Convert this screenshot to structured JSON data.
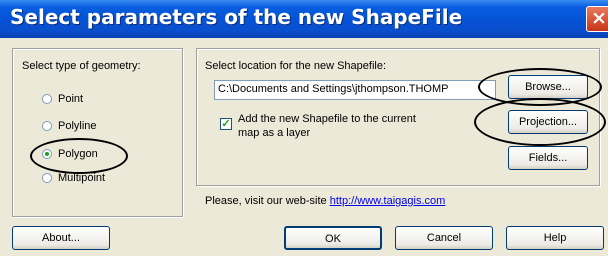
{
  "window": {
    "title": "Select parameters of the new ShapeFile",
    "close_glyph": "×"
  },
  "geometry": {
    "label": "Select type of geometry:",
    "options": [
      "Point",
      "Polyline",
      "Polygon",
      "Multipoint"
    ],
    "selected": "Polygon"
  },
  "location": {
    "label": "Select location for the new Shapefile:",
    "path_value": "C:\\Documents and Settings\\jthompson.THOMP",
    "browse_label": "Browse...",
    "add_layer_label_line1": "Add the new Shapefile to the current",
    "add_layer_label_line2": "map as a layer",
    "add_layer_checked": true,
    "check_glyph": "✓",
    "projection_label": "Projection...",
    "fields_label": "Fields..."
  },
  "website": {
    "text": "Please, visit our web-site",
    "url": "http://www.taigagis.com"
  },
  "footer": {
    "about_label": "About...",
    "ok_label": "OK",
    "cancel_label": "Cancel",
    "help_label": "Help"
  },
  "annotations": {
    "highlight_color": "#000000",
    "highlights": [
      "polygon-option",
      "browse-button",
      "projection-button"
    ]
  }
}
